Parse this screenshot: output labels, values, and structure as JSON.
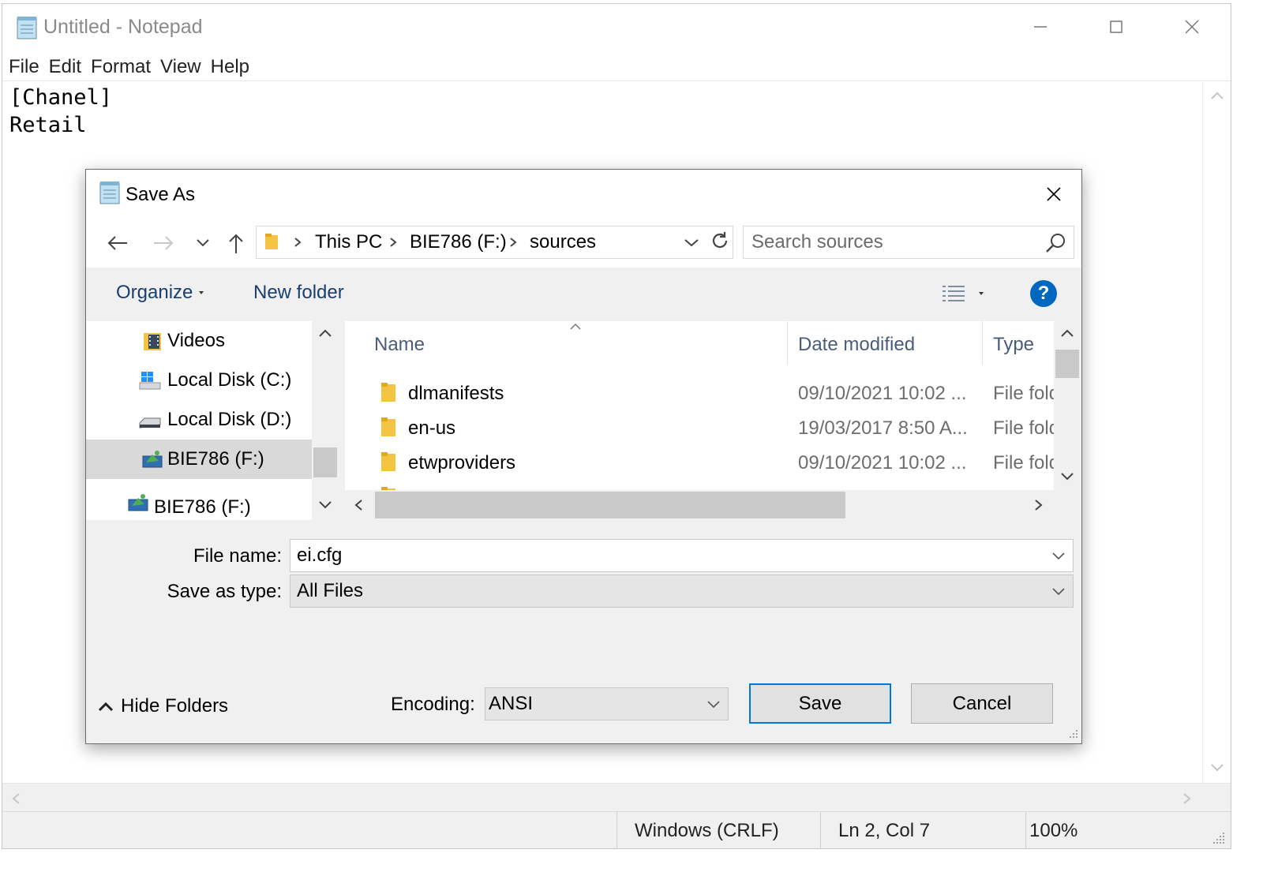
{
  "notepad": {
    "title": "Untitled - Notepad",
    "menu": [
      "File",
      "Edit",
      "Format",
      "View",
      "Help"
    ],
    "content_lines": [
      "[Chanel]",
      "Retail"
    ],
    "status": {
      "line_endings": "Windows (CRLF)",
      "position": "Ln 2, Col 7",
      "zoom": "100%"
    }
  },
  "dialog": {
    "title": "Save As",
    "breadcrumb": [
      "This PC",
      "BIE786 (F:)",
      "sources"
    ],
    "search_placeholder": "Search sources",
    "toolbar": {
      "organize": "Organize",
      "new_folder": "New folder",
      "help": "?"
    },
    "nav_items": [
      {
        "label": "Videos",
        "icon": "videos-folder-icon"
      },
      {
        "label": "Local Disk (C:)",
        "icon": "windows-drive-icon"
      },
      {
        "label": "Local Disk (D:)",
        "icon": "drive-icon"
      },
      {
        "label": "BIE786 (F:)",
        "icon": "usb-drive-icon",
        "selected": true
      },
      {
        "label": "BIE786 (F:)",
        "icon": "usb-drive-icon"
      }
    ],
    "columns": {
      "name": "Name",
      "date": "Date modified",
      "type": "Type"
    },
    "files": [
      {
        "name": "dlmanifests",
        "date": "09/10/2021 10:02 ...",
        "type": "File fold"
      },
      {
        "name": "en-us",
        "date": "19/03/2017 8:50 A...",
        "type": "File fold"
      },
      {
        "name": "etwproviders",
        "date": "09/10/2021 10:02 ...",
        "type": "File fold"
      }
    ],
    "file_name_label": "File name:",
    "file_name_value": "ei.cfg",
    "save_type_label": "Save as type:",
    "save_type_value": "All Files",
    "hide_folders": "Hide Folders",
    "encoding_label": "Encoding:",
    "encoding_value": "ANSI",
    "save_button": "Save",
    "cancel_button": "Cancel"
  }
}
